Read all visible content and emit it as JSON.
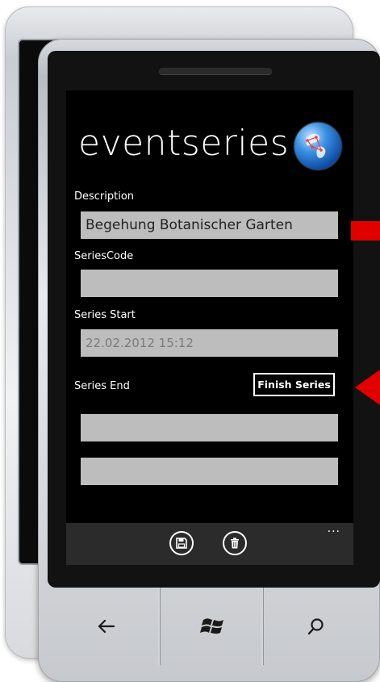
{
  "app": {
    "title": "eventseries"
  },
  "form": {
    "description_label": "Description",
    "description_value": "Begehung Botanischer Garten",
    "seriescode_label": "SeriesCode",
    "seriescode_value": "",
    "series_start_label": "Series Start",
    "series_start_value": "22.02.2012 15:12",
    "series_end_label": "Series End",
    "series_end_date_value": "",
    "series_end_time_value": "",
    "finish_button_label": "Finish Series"
  },
  "appbar": {
    "buttons": [
      {
        "icon": "save-icon"
      },
      {
        "icon": "delete-icon"
      }
    ],
    "more_label": "..."
  },
  "hardware_buttons": [
    {
      "icon": "back-arrow-icon"
    },
    {
      "icon": "windows-start-icon"
    },
    {
      "icon": "search-icon"
    }
  ],
  "colors": {
    "screen_bg": "#000000",
    "field_bg": "#bdbdbd",
    "appbar_bg": "#2b2b2b",
    "arrow_red": "#e00000"
  }
}
